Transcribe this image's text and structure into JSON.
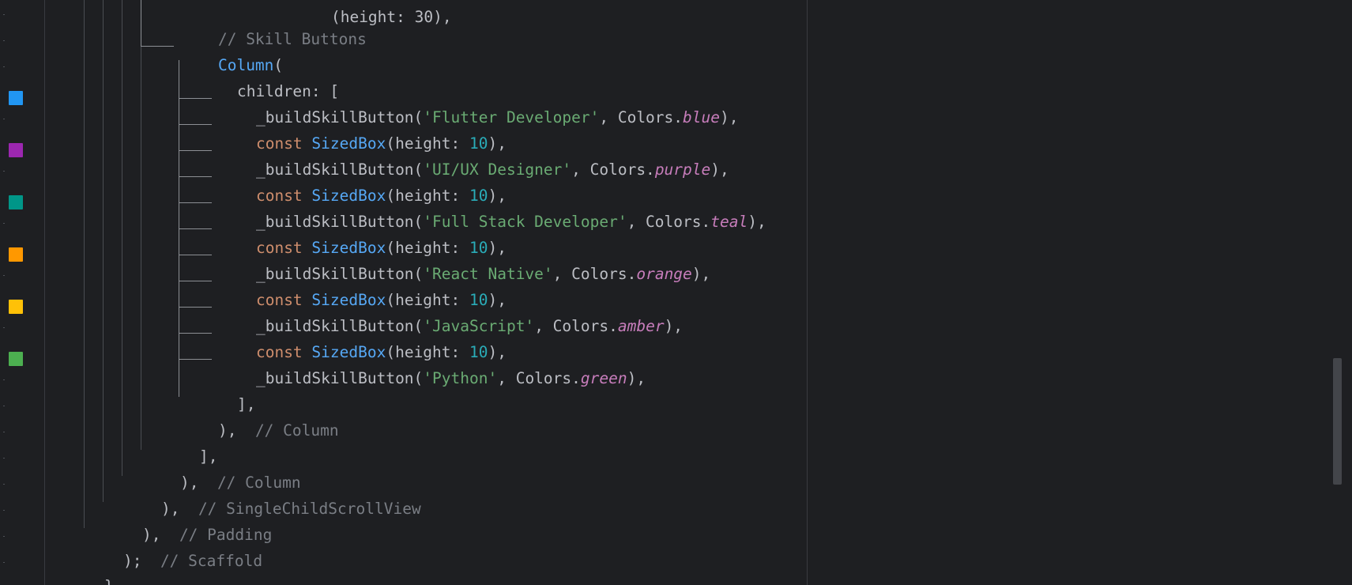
{
  "editor": {
    "color_swatches": [
      {
        "name": "blue",
        "hex": "#2196f3"
      },
      {
        "name": "purple",
        "hex": "#9c27b0"
      },
      {
        "name": "teal",
        "hex": "#009688"
      },
      {
        "name": "orange",
        "hex": "#ff9800"
      },
      {
        "name": "amber",
        "hex": "#ffc107"
      },
      {
        "name": "green",
        "hex": "#4caf50"
      }
    ],
    "lines": {
      "l0": {
        "text": "(height: 30),"
      },
      "l1": {
        "comment": "// Skill Buttons"
      },
      "l2": {
        "cls": "Column",
        "rest": "("
      },
      "l3": {
        "text": "children: ["
      },
      "l4": {
        "fn": "_buildSkillButton(",
        "str": "'Flutter Developer'",
        "mid": ", Colors.",
        "it": "blue",
        "end": "),"
      },
      "l5": {
        "kw": "const ",
        "cls": "SizedBox",
        "mid": "(height: ",
        "num": "10",
        "end": "),"
      },
      "l6": {
        "fn": "_buildSkillButton(",
        "str": "'UI/UX Designer'",
        "mid": ", Colors.",
        "it": "purple",
        "end": "),"
      },
      "l7": {
        "kw": "const ",
        "cls": "SizedBox",
        "mid": "(height: ",
        "num": "10",
        "end": "),"
      },
      "l8": {
        "fn": "_buildSkillButton(",
        "str": "'Full Stack Developer'",
        "mid": ", Colors.",
        "it": "teal",
        "end": "),"
      },
      "l9": {
        "kw": "const ",
        "cls": "SizedBox",
        "mid": "(height: ",
        "num": "10",
        "end": "),"
      },
      "l10": {
        "fn": "_buildSkillButton(",
        "str": "'React Native'",
        "mid": ", Colors.",
        "it": "orange",
        "end": "),"
      },
      "l11": {
        "kw": "const ",
        "cls": "SizedBox",
        "mid": "(height: ",
        "num": "10",
        "end": "),"
      },
      "l12": {
        "fn": "_buildSkillButton(",
        "str": "'JavaScript'",
        "mid": ", Colors.",
        "it": "amber",
        "end": "),"
      },
      "l13": {
        "kw": "const ",
        "cls": "SizedBox",
        "mid": "(height: ",
        "num": "10",
        "end": "),"
      },
      "l14": {
        "fn": "_buildSkillButton(",
        "str": "'Python'",
        "mid": ", Colors.",
        "it": "green",
        "end": "),"
      },
      "l15": {
        "text": "],"
      },
      "l16": {
        "text": "),  ",
        "comment": "// Column"
      },
      "l17": {
        "text": "],"
      },
      "l18": {
        "text": "),  ",
        "comment": "// Column"
      },
      "l19": {
        "text": "),  ",
        "comment": "// SingleChildScrollView"
      },
      "l20": {
        "text": "),  ",
        "comment": "// Padding"
      },
      "l21": {
        "text": ");  ",
        "comment": "// Scaffold"
      },
      "l22": {
        "text": "}"
      }
    }
  }
}
